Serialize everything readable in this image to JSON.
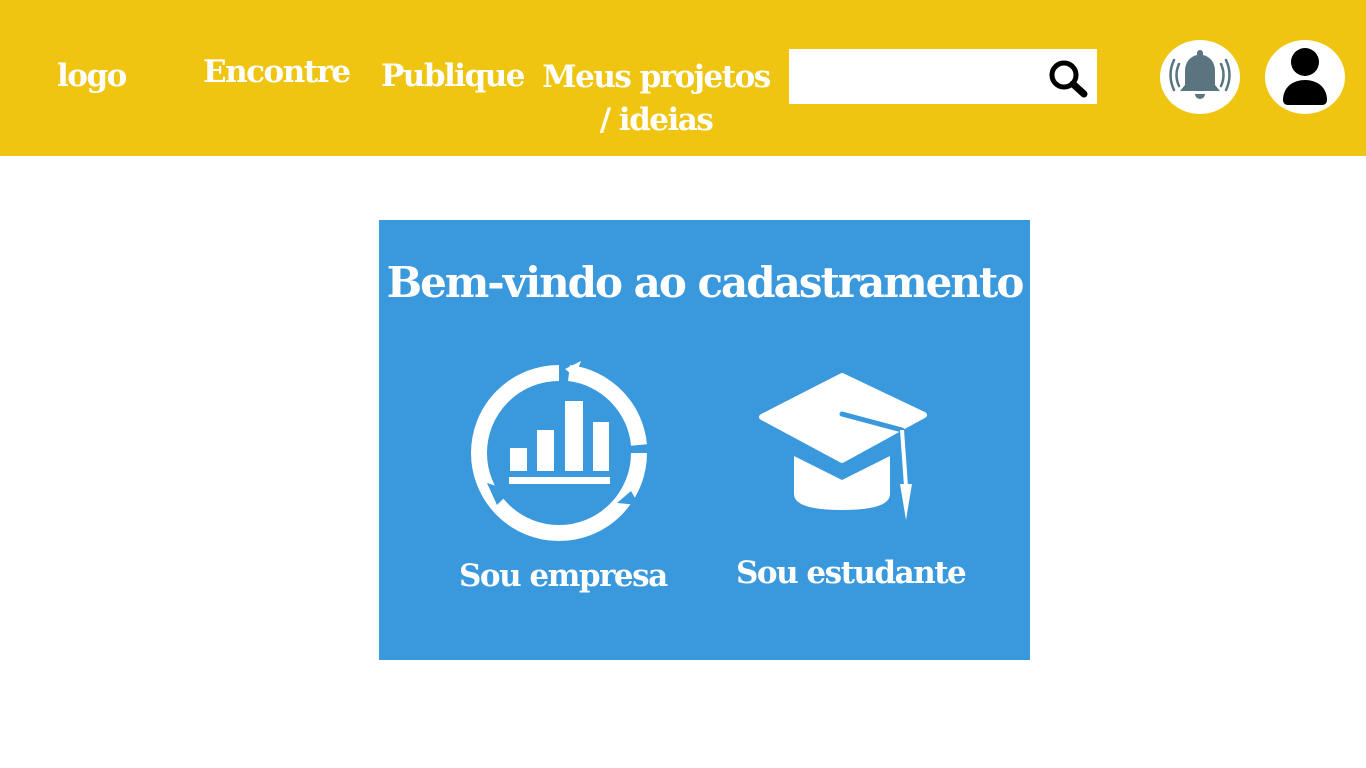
{
  "header": {
    "logo": "logo",
    "nav": {
      "encontre": "Encontre",
      "publique": "Publique",
      "meus_projetos": "Meus projetos / ideias"
    },
    "search": {
      "value": "",
      "icon": "search-icon"
    },
    "notifications_icon": "bell-ringing-icon",
    "profile_icon": "user-icon"
  },
  "signup": {
    "title": "Bem-vindo ao cadastramento",
    "options": {
      "empresa": {
        "label": "Sou empresa",
        "icon": "chart-cycle-icon"
      },
      "estudante": {
        "label": "Sou estudante",
        "icon": "graduation-cap-icon"
      }
    }
  },
  "colors": {
    "header_bg": "#f0c512",
    "card_bg": "#3a98dc",
    "bell": "#5a7480"
  }
}
